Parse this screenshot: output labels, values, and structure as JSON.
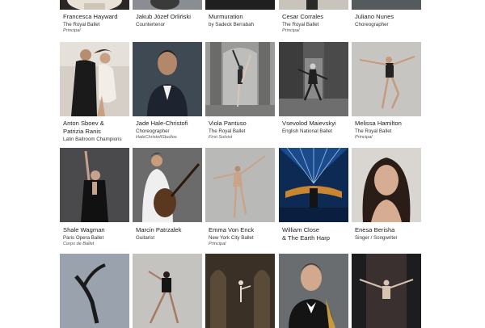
{
  "artists": [
    {
      "name": "Francesca Hayward",
      "sub": "The Royal Ballet",
      "note": "Principal"
    },
    {
      "name": "Jakub Józef Orliński",
      "sub": "Countertenor",
      "note": ""
    },
    {
      "name": "Murmuration",
      "sub": "by Sadeck Berrabah",
      "note": ""
    },
    {
      "name": "Cesar Corrales",
      "sub": "The Royal Ballet",
      "note": "Principal"
    },
    {
      "name": "Juliano Nunes",
      "sub": "Choreographer",
      "note": ""
    },
    {
      "name": "Anton Sboev &\nPatrizia Ranis",
      "sub": "Latin Ballroom Champions",
      "note": ""
    },
    {
      "name": "Jade Hale-Christofi",
      "sub": "Choreographer",
      "note": "HaleChristofiStudios"
    },
    {
      "name": "Viola Pantuso",
      "sub": "The Royal Ballet",
      "note": "First Soloist"
    },
    {
      "name": "Vsevolod Maievskyi",
      "sub": "English National Ballet",
      "note": ""
    },
    {
      "name": "Melissa Hamilton",
      "sub": "The Royal Ballet",
      "note": "Principal"
    },
    {
      "name": "Shale Wagman",
      "sub": "Paris Opera Ballet",
      "note": "Corps de Ballet"
    },
    {
      "name": "Marcin Patrzalek",
      "sub": "Guitarist",
      "note": ""
    },
    {
      "name": "Emma Von Enck",
      "sub": "New York City Ballet",
      "note": "Principal"
    },
    {
      "name": "William Close\n& The Earth Harp",
      "sub": "",
      "note": ""
    },
    {
      "name": "Enesa Berisha",
      "sub": "Singer / Songwriter",
      "note": ""
    }
  ]
}
